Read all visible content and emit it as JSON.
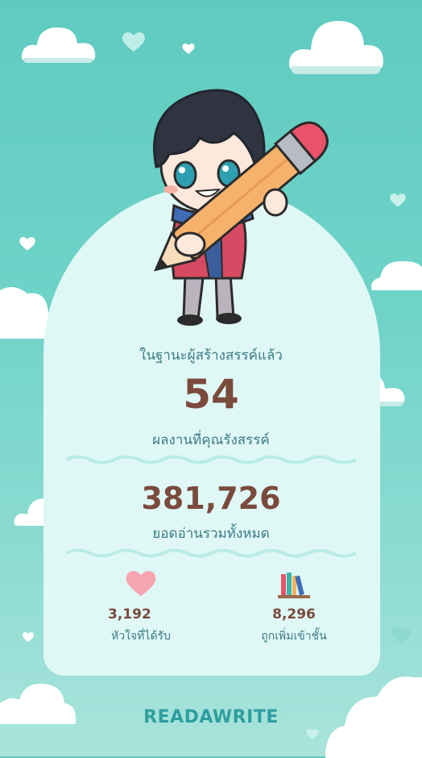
{
  "header": {
    "caption": "ในฐานะผู้สร้างสรรค์แล้ว"
  },
  "works": {
    "count": "54",
    "label": "ผลงานที่คุณรังสรรค์"
  },
  "reads": {
    "count": "381,726",
    "label": "ยอดอ่านรวมทั้งหมด"
  },
  "stats": {
    "hearts": {
      "value": "3,192",
      "label": "หัวใจที่ได้รับ",
      "icon": "heart-icon"
    },
    "shelves": {
      "value": "8,296",
      "label": "ถูกเพิ่มเข้าชั้น",
      "icon": "books-icon"
    }
  },
  "brand": {
    "logo": "READAWRITE"
  },
  "colors": {
    "background": "#5fcbc0",
    "card": "#dff8f6",
    "number": "#7a4a3d",
    "label": "#3d7a85",
    "brand": "#2f9e9f"
  }
}
